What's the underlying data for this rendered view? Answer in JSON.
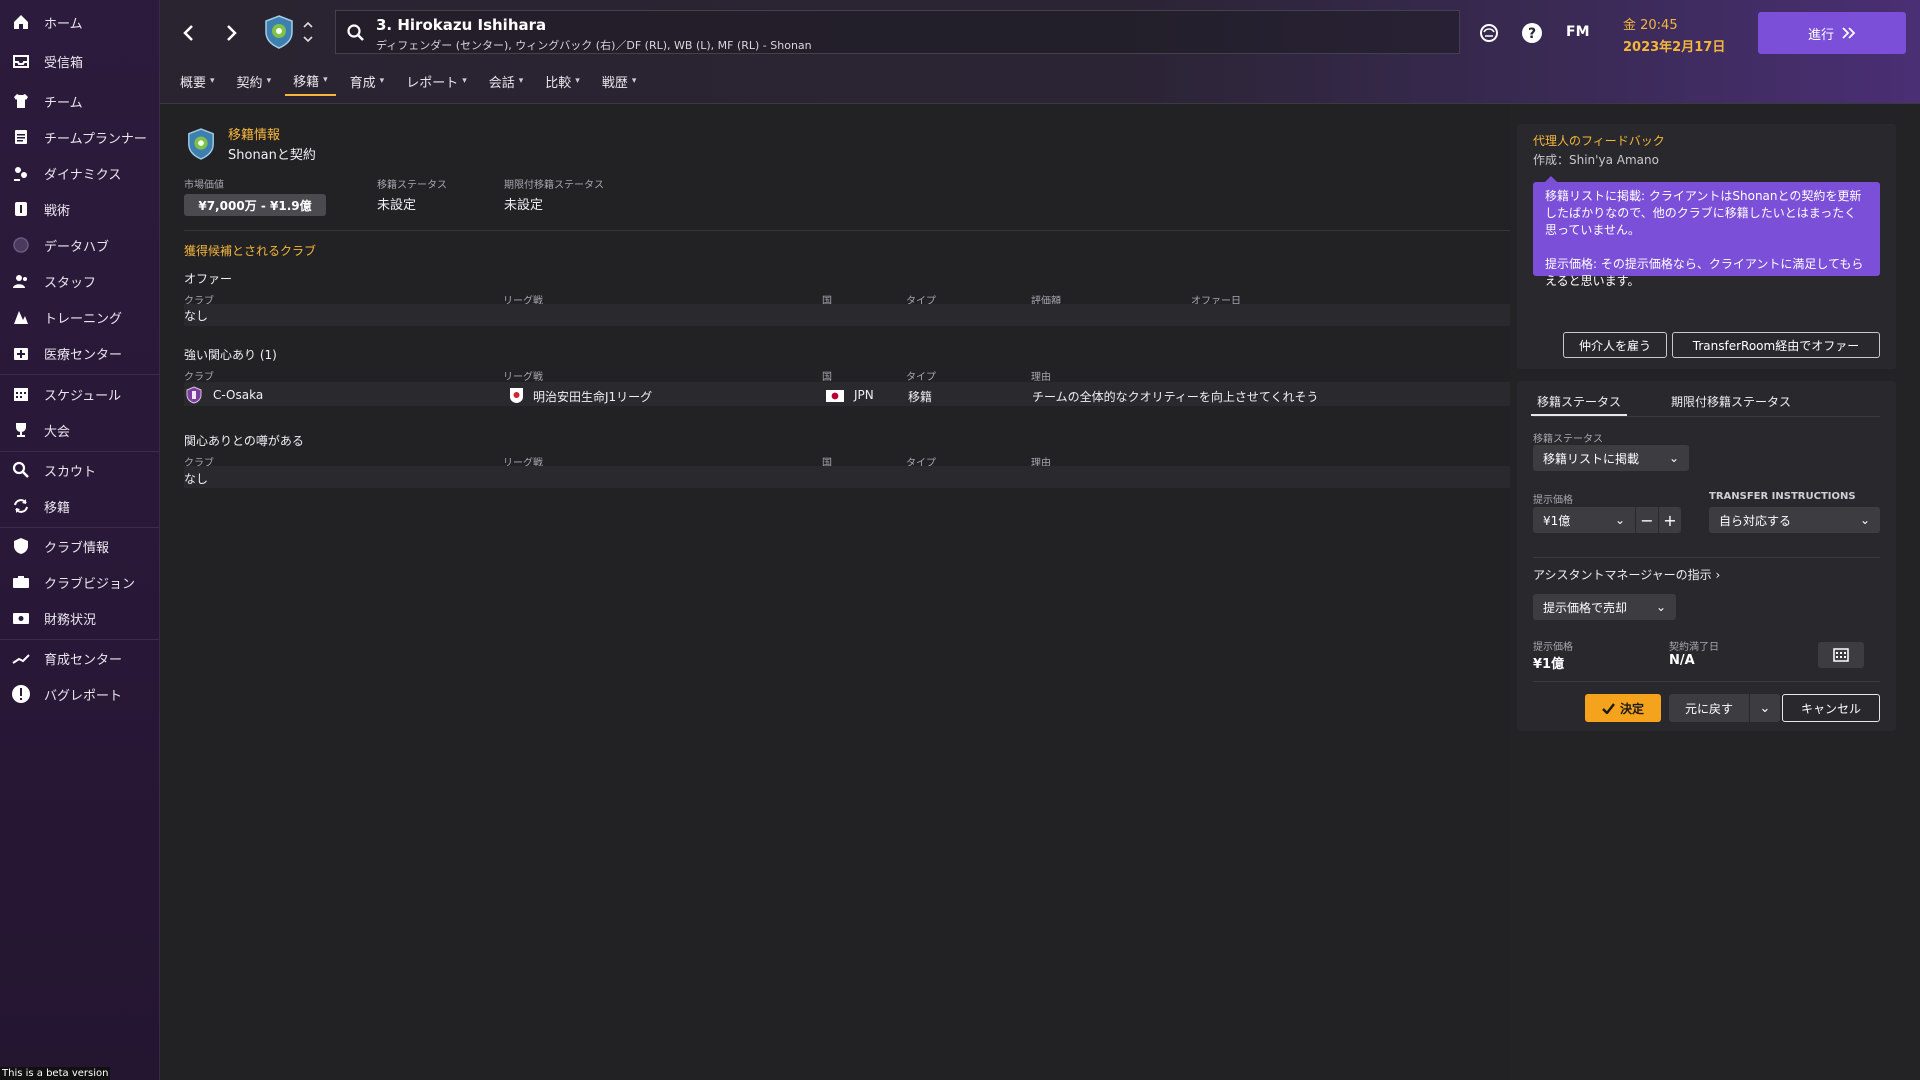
{
  "sidebar": {
    "items": [
      {
        "label": "ホーム",
        "icon": "home-icon"
      },
      {
        "label": "受信箱",
        "icon": "inbox-icon"
      },
      {
        "label": "チーム",
        "icon": "shirt-icon"
      },
      {
        "label": "チームプランナー",
        "icon": "clipboard-icon"
      },
      {
        "label": "ダイナミクス",
        "icon": "dynamics-icon"
      },
      {
        "label": "戦術",
        "icon": "tactics-icon"
      },
      {
        "label": "データハブ",
        "icon": "data-hub-icon"
      },
      {
        "label": "スタッフ",
        "icon": "staff-icon"
      },
      {
        "label": "トレーニング",
        "icon": "training-icon"
      },
      {
        "label": "医療センター",
        "icon": "medical-icon"
      },
      {
        "label": "スケジュール",
        "icon": "calendar-icon"
      },
      {
        "label": "大会",
        "icon": "trophy-icon"
      },
      {
        "label": "スカウト",
        "icon": "search-icon"
      },
      {
        "label": "移籍",
        "icon": "transfer-icon"
      },
      {
        "label": "クラブ情報",
        "icon": "shield-icon"
      },
      {
        "label": "クラブビジョン",
        "icon": "vision-icon"
      },
      {
        "label": "財務状況",
        "icon": "finance-icon"
      },
      {
        "label": "育成センター",
        "icon": "development-icon"
      },
      {
        "label": "バグレポート",
        "icon": "alert-icon"
      }
    ],
    "beta_notice": "This is a beta version"
  },
  "header": {
    "player_name": "3. Hirokazu Ishihara",
    "player_subtitle": "ディフェンダー (センター), ウィングバック (右)／DF (RL), WB (L), MF (RL) - Shonan",
    "logo": "FM",
    "time": "金 20:45",
    "date": "2023年2月17日",
    "continue_label": "進行",
    "tabs": [
      {
        "label": "概要",
        "active": false
      },
      {
        "label": "契約",
        "active": false
      },
      {
        "label": "移籍",
        "active": true
      },
      {
        "label": "育成",
        "active": false
      },
      {
        "label": "レポート",
        "active": false
      },
      {
        "label": "会話",
        "active": false
      },
      {
        "label": "比較",
        "active": false
      },
      {
        "label": "戦歴",
        "active": false
      }
    ]
  },
  "transfer_info": {
    "title": "移籍情報",
    "subtitle": "Shonanと契約",
    "market_value_label": "市場価値",
    "market_value": "¥7,000万 - ¥1.9億",
    "transfer_status_label": "移籍ステータス",
    "transfer_status": "未設定",
    "loan_status_label": "期限付移籍ステータス",
    "loan_status": "未設定"
  },
  "candidates": {
    "title": "獲得候補とされるクラブ",
    "offers": {
      "title": "オファー",
      "columns": [
        "クラブ",
        "リーグ戦",
        "国",
        "タイプ",
        "評価額",
        "オファー日"
      ],
      "empty": "なし"
    },
    "strong_interest": {
      "title": "強い関心あり (1)",
      "columns": [
        "クラブ",
        "リーグ戦",
        "国",
        "タイプ",
        "理由"
      ],
      "rows": [
        {
          "club": "C-Osaka",
          "league": "明治安田生命J1リーグ",
          "country": "JPN",
          "type": "移籍",
          "reason": "チームの全体的なクオリティーを向上させてくれそう"
        }
      ]
    },
    "rumoured": {
      "title": "関心ありとの噂がある",
      "columns": [
        "クラブ",
        "リーグ戦",
        "国",
        "タイプ",
        "理由"
      ],
      "empty": "なし"
    }
  },
  "agent_feedback": {
    "title": "代理人のフィードバック",
    "author": "作成：Shin'ya Amano",
    "message_1": "移籍リストに掲載: クライアントはShonanとの契約を更新したばかりなので、他のクラブに移籍したいとはまったく思っていません。",
    "message_2": "提示価格: その提示価格なら、クライアントに満足してもらえると思います。",
    "hire_intermediary": "仲介人を雇う",
    "transferroom_offer": "TransferRoom経由でオファー"
  },
  "status_panel": {
    "tab_transfer": "移籍ステータス",
    "tab_loan": "期限付移籍ステータス",
    "status_label": "移籍ステータス",
    "status_value": "移籍リストに掲載",
    "price_label": "提示価格",
    "price_value": "¥1億",
    "instructions_label": "TRANSFER INSTRUCTIONS",
    "instructions_value": "自ら対応する",
    "assistant_link": "アシスタントマネージャーの指示",
    "assistant_value": "提示価格で売却",
    "asking_price_label": "提示価格",
    "asking_price_value": "¥1億",
    "contract_expiry_label": "契約満了日",
    "contract_expiry_value": "N/A",
    "confirm_label": "決定",
    "revert_label": "元に戻す",
    "cancel_label": "キャンセル"
  },
  "colors": {
    "accent": "#f5b63a",
    "purple": "#7b4fd8",
    "confirm": "#f5a21c"
  }
}
